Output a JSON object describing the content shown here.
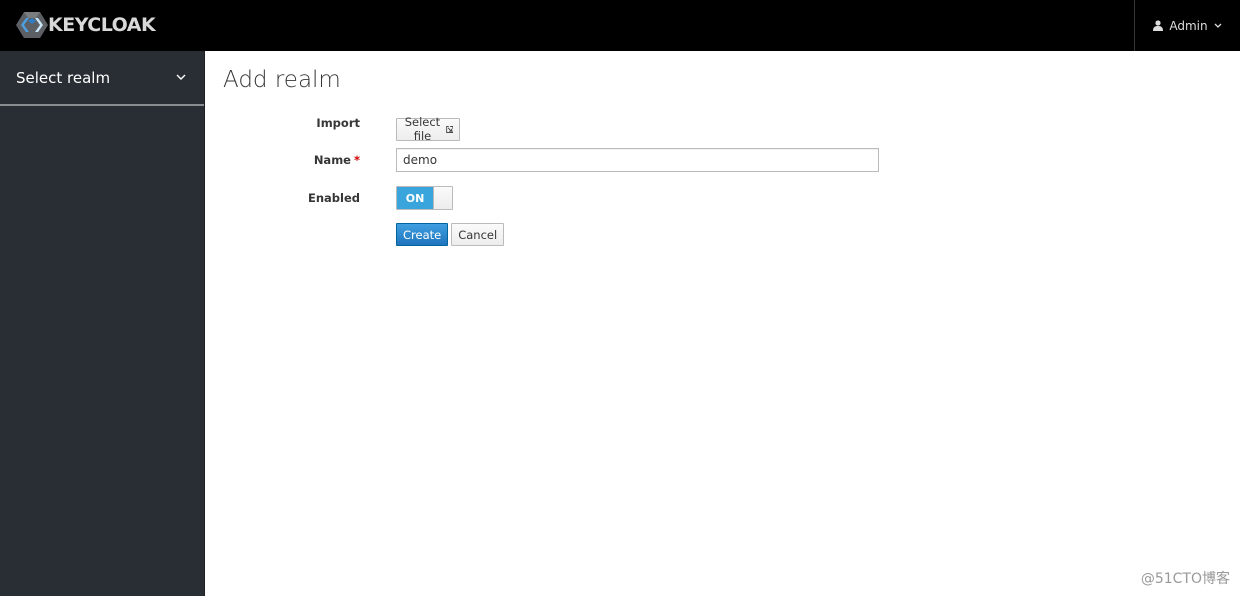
{
  "header": {
    "brand": "KEYCLOAK",
    "user_label": "Admin",
    "user_icon": "user-icon",
    "user_chevron_icon": "chevron-down-icon"
  },
  "sidebar": {
    "realm_selector_label": "Select realm",
    "realm_chevron_icon": "chevron-down-icon"
  },
  "main": {
    "title": "Add realm",
    "form": {
      "import_label": "Import",
      "select_file_label": "Select file",
      "select_file_icon": "import-icon",
      "name_label": "Name",
      "name_required_marker": "*",
      "name_value": "demo",
      "enabled_label": "Enabled",
      "enabled_state": "ON",
      "enabled_value": true,
      "create_label": "Create",
      "cancel_label": "Cancel"
    }
  },
  "watermark": "@51CTO博客",
  "colors": {
    "topbar": "#000000",
    "sidebar": "#292e34",
    "primary": "#1f74bd",
    "toggle_on": "#39a5dc",
    "required": "#cc0000"
  }
}
